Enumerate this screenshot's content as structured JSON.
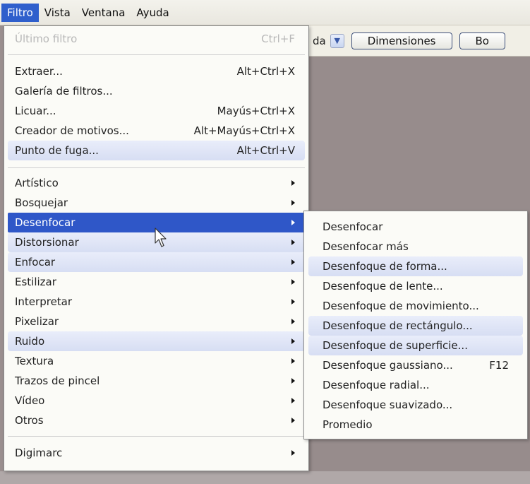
{
  "menubar": {
    "items": [
      {
        "label": "Filtro",
        "active": true
      },
      {
        "label": "Vista",
        "active": false
      },
      {
        "label": "Ventana",
        "active": false
      },
      {
        "label": "Ayuda",
        "active": false
      }
    ]
  },
  "options_bar": {
    "select_value": "da",
    "dimensions_button": "Dimensiones",
    "partial_button": "Bo"
  },
  "filter_menu": {
    "last_filter": {
      "label": "Último filtro",
      "shortcut": "Ctrl+F",
      "disabled": true
    },
    "group1": [
      {
        "label": "Extraer...",
        "shortcut": "Alt+Ctrl+X"
      },
      {
        "label": "Galería de filtros..."
      },
      {
        "label": "Licuar...",
        "shortcut": "Mayús+Ctrl+X"
      },
      {
        "label": "Creador de motivos...",
        "shortcut": "Alt+Mayús+Ctrl+X"
      },
      {
        "label": "Punto de fuga...",
        "shortcut": "Alt+Ctrl+V"
      }
    ],
    "group2": [
      {
        "label": "Artístico"
      },
      {
        "label": "Bosquejar"
      },
      {
        "label": "Desenfocar"
      },
      {
        "label": "Distorsionar"
      },
      {
        "label": "Enfocar"
      },
      {
        "label": "Estilizar"
      },
      {
        "label": "Interpretar"
      },
      {
        "label": "Pixelizar"
      },
      {
        "label": "Ruido"
      },
      {
        "label": "Textura"
      },
      {
        "label": "Trazos de pincel"
      },
      {
        "label": "Vídeo"
      },
      {
        "label": "Otros"
      }
    ],
    "group3": [
      {
        "label": "Digimarc"
      }
    ]
  },
  "submenu_desenfocar": [
    {
      "label": "Desenfocar"
    },
    {
      "label": "Desenfocar más"
    },
    {
      "label": "Desenfoque de forma..."
    },
    {
      "label": "Desenfoque de lente..."
    },
    {
      "label": "Desenfoque de movimiento..."
    },
    {
      "label": "Desenfoque de rectángulo..."
    },
    {
      "label": "Desenfoque de superficie..."
    },
    {
      "label": "Desenfoque gaussiano...",
      "shortcut": "F12"
    },
    {
      "label": "Desenfoque radial..."
    },
    {
      "label": "Desenfoque suavizado..."
    },
    {
      "label": "Promedio"
    }
  ],
  "colors": {
    "selected": "#2f57c8",
    "highlight": "#d7def3"
  }
}
